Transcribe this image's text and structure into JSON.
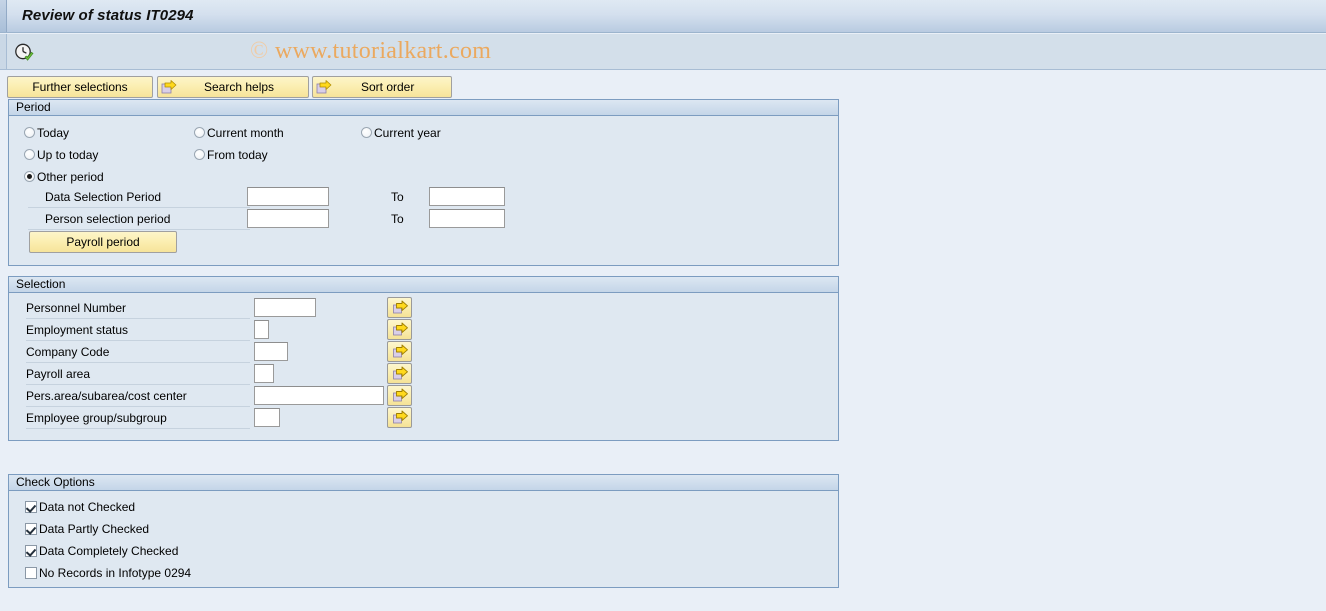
{
  "window": {
    "title": "Review of status IT0294",
    "watermark_copyright": "©",
    "watermark_text": "www.tutorialkart.com",
    "clock_icon": "clock-check-icon"
  },
  "toolbar": {
    "buttons": [
      {
        "label": "Further selections",
        "icon": ""
      },
      {
        "label": "Search helps",
        "icon": "arrow-right-icon"
      },
      {
        "label": "Sort order",
        "icon": "arrow-right-icon"
      }
    ]
  },
  "period": {
    "title": "Period",
    "radios": [
      {
        "label": "Today",
        "selected": false
      },
      {
        "label": "Current month",
        "selected": false
      },
      {
        "label": "Current year",
        "selected": false
      },
      {
        "label": "Up to today",
        "selected": false
      },
      {
        "label": "From today",
        "selected": false
      },
      {
        "label": "Other period",
        "selected": true
      }
    ],
    "rows": [
      {
        "label": "Data Selection Period",
        "value": "",
        "to_label": "To",
        "to_value": ""
      },
      {
        "label": "Person selection period",
        "value": "",
        "to_label": "To",
        "to_value": ""
      }
    ],
    "payroll_button": "Payroll period"
  },
  "selection": {
    "title": "Selection",
    "rows": [
      {
        "label": "Personnel Number",
        "value": "",
        "select_icon": "arrow-right-icon"
      },
      {
        "label": "Employment status",
        "value": "",
        "select_icon": "arrow-right-icon"
      },
      {
        "label": "Company Code",
        "value": "",
        "select_icon": "arrow-right-icon"
      },
      {
        "label": "Payroll area",
        "value": "",
        "select_icon": "arrow-right-icon"
      },
      {
        "label": "Pers.area/subarea/cost center",
        "value": "",
        "select_icon": "arrow-right-icon"
      },
      {
        "label": "Employee group/subgroup",
        "value": "",
        "select_icon": "arrow-right-icon"
      }
    ]
  },
  "check_options": {
    "title": "Check Options",
    "items": [
      {
        "label": "Data not Checked",
        "checked": true
      },
      {
        "label": "Data Partly Checked",
        "checked": true
      },
      {
        "label": "Data Completely Checked",
        "checked": true
      },
      {
        "label": "No Records in Infotype 0294",
        "checked": false
      }
    ]
  },
  "colors": {
    "title_bar": "#c8d8e8",
    "body": "#e9eff7",
    "group_bg": "#dfe8f1",
    "button_yellow": "#fbeeb0",
    "accent_border": "#7c9cc0",
    "watermark": "#eba95f"
  }
}
